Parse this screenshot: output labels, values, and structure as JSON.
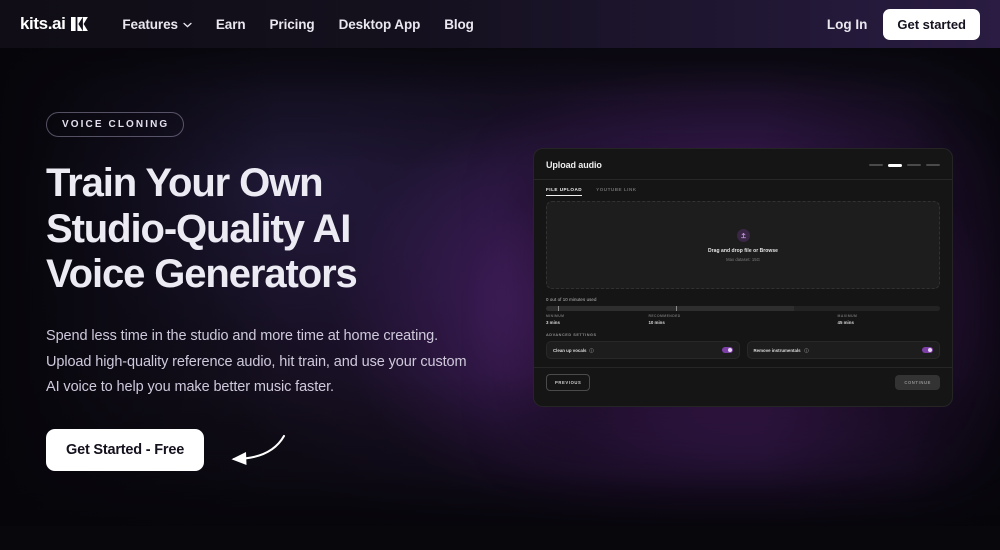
{
  "nav": {
    "logo_text": "kits.ai",
    "logo_mark": "k-logo-icon",
    "links": [
      {
        "label": "Features",
        "has_caret": true
      },
      {
        "label": "Earn",
        "has_caret": false
      },
      {
        "label": "Pricing",
        "has_caret": false
      },
      {
        "label": "Desktop App",
        "has_caret": false
      },
      {
        "label": "Blog",
        "has_caret": false
      }
    ],
    "login_label": "Log In",
    "cta_label": "Get started"
  },
  "hero": {
    "eyebrow": "VOICE CLONING",
    "headline_lines": [
      "Train Your Own",
      "Studio-Quality AI",
      "Voice Generators"
    ],
    "paragraph": "Spend less time in the studio and more time at home creating.  Upload high-quality reference audio, hit train, and use your custom AI voice to help you make better music faster.",
    "cta_label": "Get Started - Free",
    "arrow_icon": "curved-arrow-left-icon"
  },
  "app": {
    "title": "Upload audio",
    "steps": {
      "total": 4,
      "active_index": 1
    },
    "tabs": [
      {
        "label": "FILE UPLOAD",
        "active": true
      },
      {
        "label": "YOUTUBE LINK",
        "active": false
      }
    ],
    "dropzone": {
      "icon": "upload-icon",
      "primary": "Drag and drop file or Browse",
      "secondary": "Max dataset: 15G"
    },
    "usage": {
      "label": "0 out of 10 minutes used",
      "fill_percent": 63,
      "ticks_percent": [
        3,
        33
      ],
      "marks": [
        {
          "caption": "MINIMUM",
          "value": "3 mins",
          "left_percent": 0
        },
        {
          "caption": "RECOMMENDED",
          "value": "10 mins",
          "left_percent": 26
        },
        {
          "caption": "MAXIMUM",
          "value": "45 mins",
          "left_percent": 74
        }
      ]
    },
    "advanced": {
      "section_label": "ADVANCED SETTINGS",
      "toggles": [
        {
          "label": "Clean up vocals",
          "on": true,
          "info_icon": "info-icon"
        },
        {
          "label": "Remove instrumentals",
          "on": true,
          "info_icon": "info-icon"
        }
      ]
    },
    "footer": {
      "previous_label": "PREVIOUS",
      "continue_label": "CONTINUE"
    }
  },
  "colors": {
    "accent_purple": "#7b3fa5",
    "hero_glow": "#963ebe",
    "page_bg": "#0a0910",
    "panel_bg": "#151515"
  }
}
